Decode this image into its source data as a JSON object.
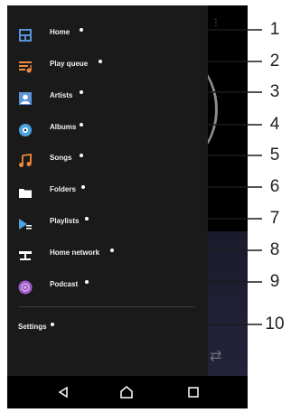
{
  "menu": {
    "items": [
      {
        "label": "Home",
        "icon": "home-icon",
        "color": "#5a93d6"
      },
      {
        "label": "Play queue",
        "icon": "play-queue-icon",
        "color": "#f08a3a"
      },
      {
        "label": "Artists",
        "icon": "artist-icon",
        "color": "#5a93d6"
      },
      {
        "label": "Albums",
        "icon": "album-icon",
        "color": "#4aa3e0"
      },
      {
        "label": "Songs",
        "icon": "music-note-icon",
        "color": "#f08a3a"
      },
      {
        "label": "Folders",
        "icon": "folder-icon",
        "color": "#ffffff"
      },
      {
        "label": "Playlists",
        "icon": "playlist-icon",
        "color": "#4aa3e0"
      },
      {
        "label": "Home network",
        "icon": "home-network-icon",
        "color": "#ffffff"
      },
      {
        "label": "Podcast",
        "icon": "podcast-icon",
        "color": "#a05cc8"
      }
    ],
    "settings_label": "Settings"
  },
  "callouts": {
    "numbers": [
      "1",
      "2",
      "3",
      "4",
      "5",
      "6",
      "7",
      "8",
      "9",
      "10"
    ]
  },
  "navbar": {
    "buttons": [
      "back-icon",
      "home-button-icon",
      "recent-apps-icon"
    ]
  },
  "colors": {
    "drawer_bg": "#1a1a1a",
    "screen_bg": "#0c0c0c",
    "accent_blue": "#5a93d6",
    "accent_orange": "#f08a3a",
    "accent_purple": "#a05cc8"
  }
}
